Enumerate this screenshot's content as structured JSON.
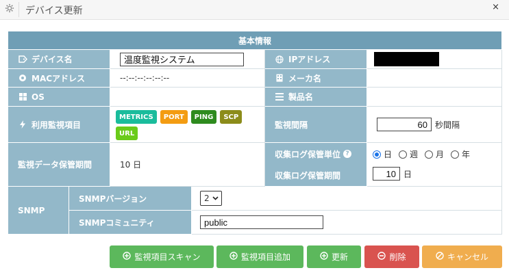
{
  "window": {
    "title": "デバイス更新",
    "close_label": "×"
  },
  "section": {
    "header": "基本情報"
  },
  "fields": {
    "device_name": {
      "label": "デバイス名",
      "value": "温度監視システム"
    },
    "ip_address": {
      "label": "IPアドレス"
    },
    "mac_address": {
      "label": "MACアドレス",
      "value": "--:--:--:--:--:--"
    },
    "maker_name": {
      "label": "メーカ名",
      "value": ""
    },
    "os": {
      "label": "OS",
      "value": ""
    },
    "product_name": {
      "label": "製品名",
      "value": ""
    },
    "monitor_items": {
      "label": "利用監視項目",
      "tags": [
        {
          "label": "METRICS",
          "color": "#1abc9c"
        },
        {
          "label": "PORT",
          "color": "#f39c12"
        },
        {
          "label": "PING",
          "color": "#2e8b1e"
        },
        {
          "label": "SCP",
          "color": "#8c8c1a"
        },
        {
          "label": "URL",
          "color": "#6acb1a"
        }
      ]
    },
    "monitor_interval": {
      "label": "監視間隔",
      "value": "60",
      "unit": "秒間隔"
    },
    "data_retention": {
      "label": "監視データ保管期間",
      "value": "10 日"
    },
    "log_unit": {
      "label": "収集ログ保管単位",
      "help": "?",
      "options": [
        "日",
        "週",
        "月",
        "年"
      ],
      "selected": "日"
    },
    "log_period": {
      "label": "収集ログ保管期間",
      "value": "10",
      "unit": "日"
    },
    "snmp": {
      "label": "SNMP",
      "version_label": "SNMPバージョン",
      "version_value": "2",
      "community_label": "SNMPコミュニティ",
      "community_value": "public"
    }
  },
  "buttons": {
    "scan": {
      "label": "監視項目スキャン",
      "color": "#5cb85c"
    },
    "add": {
      "label": "監視項目追加",
      "color": "#5cb85c"
    },
    "update": {
      "label": "更新",
      "color": "#5cb85c"
    },
    "delete": {
      "label": "削除",
      "color": "#d9534f"
    },
    "cancel": {
      "label": "キャンセル",
      "color": "#f0ad4e"
    }
  }
}
